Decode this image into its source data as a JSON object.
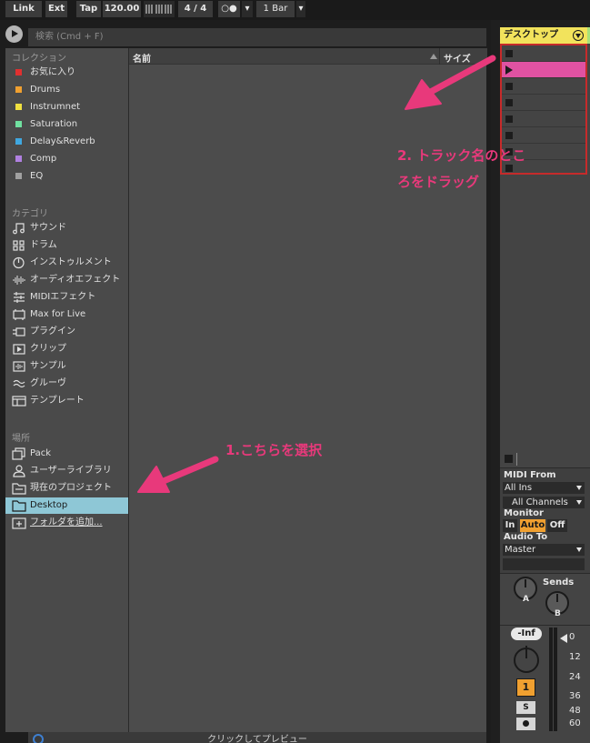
{
  "transport": {
    "link": "Link",
    "ext": "Ext",
    "tap": "Tap",
    "tempo": "120.00",
    "signature": "4 / 4",
    "metronome": "○●",
    "quantize": "1 Bar"
  },
  "browser": {
    "search_placeholder": "検索 (Cmd + F)",
    "collections_header": "コレクション",
    "collections": [
      {
        "label": "お気に入り",
        "color": "#e03030"
      },
      {
        "label": "Drums",
        "color": "#f0a030"
      },
      {
        "label": "Instrumnet",
        "color": "#f0e040"
      },
      {
        "label": "Saturation",
        "color": "#70e0a0"
      },
      {
        "label": "Delay&Reverb",
        "color": "#40a8e0"
      },
      {
        "label": "Comp",
        "color": "#b080e0"
      },
      {
        "label": "EQ",
        "color": "#a0a0a0"
      }
    ],
    "categories_header": "カテゴリ",
    "categories": [
      {
        "label": "サウンド",
        "icon": "note-icon"
      },
      {
        "label": "ドラム",
        "icon": "drum-grid-icon"
      },
      {
        "label": "インストゥルメント",
        "icon": "instrument-clock-icon"
      },
      {
        "label": "オーディオエフェクト",
        "icon": "waveform-icon"
      },
      {
        "label": "MIDIエフェクト",
        "icon": "midi-effect-icon"
      },
      {
        "label": "Max for Live",
        "icon": "max-for-live-icon"
      },
      {
        "label": "プラグイン",
        "icon": "plugin-icon"
      },
      {
        "label": "クリップ",
        "icon": "clip-icon"
      },
      {
        "label": "サンプル",
        "icon": "sample-icon"
      },
      {
        "label": "グルーヴ",
        "icon": "groove-icon"
      },
      {
        "label": "テンプレート",
        "icon": "template-icon"
      }
    ],
    "places_header": "場所",
    "places": [
      {
        "label": "Pack",
        "icon": "pack-icon"
      },
      {
        "label": "ユーザーライブラリ",
        "icon": "user-icon"
      },
      {
        "label": "現在のプロジェクト",
        "icon": "project-folder-icon"
      },
      {
        "label": "Desktop",
        "icon": "folder-icon",
        "selected": true
      },
      {
        "label": "フォルダを追加...",
        "icon": "add-folder-icon"
      }
    ],
    "columns": {
      "name": "名前",
      "size": "サイズ"
    },
    "preview_label": "クリックしてプレビュー"
  },
  "track": {
    "title": "デスクトップ",
    "title_color": "#f2e35c",
    "clip_color": "#e052a2",
    "midi_from_label": "MIDI From",
    "midi_from_value": "All Ins",
    "channel_value": "All Channels",
    "monitor_label": "Monitor",
    "monitor_options": [
      "In",
      "Auto",
      "Off"
    ],
    "monitor_selected": "Auto",
    "audio_to_label": "Audio To",
    "audio_to_value": "Master",
    "sends_label": "Sends",
    "send_a": "A",
    "send_b": "B",
    "volume": "-Inf",
    "track_number": "1",
    "solo": "S",
    "db_scale": [
      "0",
      "12",
      "24",
      "36",
      "48",
      "60"
    ]
  },
  "annotations": {
    "step2_line1": "2.  トラック名のとこ",
    "step2_line2": "ろをドラッグ",
    "step1": "1.こちらを選択",
    "color": "#e8397b"
  }
}
